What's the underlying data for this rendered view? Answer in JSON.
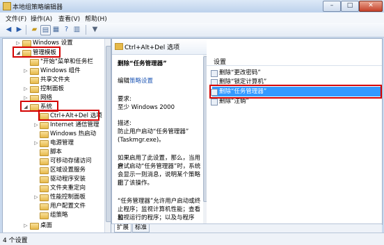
{
  "window": {
    "title": "本地组策略编辑器",
    "min": "–",
    "max": "□",
    "close": "✕"
  },
  "menu": [
    "文件(F)",
    "操作(A)",
    "查看(V)",
    "帮助(H)"
  ],
  "toolbar_icons": [
    "back-icon",
    "forward-icon",
    "folder-up-icon",
    "show-hide-tree-icon",
    "properties-icon",
    "help-icon",
    "export-list-icon",
    "filter-icon"
  ],
  "tree": {
    "items": [
      {
        "label": "Windows 设置",
        "arrow": "▷"
      },
      {
        "label": "管理模板",
        "arrow": "◢"
      },
      {
        "label": "\"开始\"菜单和任务栏",
        "arrow": ""
      },
      {
        "label": "Windows 组件",
        "arrow": "▷"
      },
      {
        "label": "共享文件夹",
        "arrow": ""
      },
      {
        "label": "控制面板",
        "arrow": "▷"
      },
      {
        "label": "网络",
        "arrow": "▷"
      },
      {
        "label": "系统",
        "arrow": "◢"
      },
      {
        "label": "Ctrl+Alt+Del 选项",
        "arrow": ""
      },
      {
        "label": "Internet 通信管理",
        "arrow": "▷"
      },
      {
        "label": "Windows 热启动",
        "arrow": ""
      },
      {
        "label": "电源管理",
        "arrow": "▷"
      },
      {
        "label": "脚本",
        "arrow": ""
      },
      {
        "label": "可移动存储访问",
        "arrow": ""
      },
      {
        "label": "区域设置服务",
        "arrow": ""
      },
      {
        "label": "驱动程序安装",
        "arrow": ""
      },
      {
        "label": "文件夹重定向",
        "arrow": ""
      },
      {
        "label": "性能控制面板",
        "arrow": "▷"
      },
      {
        "label": "用户配置文件",
        "arrow": ""
      },
      {
        "label": "组策略",
        "arrow": ""
      },
      {
        "label": "桌面",
        "arrow": "▷"
      }
    ]
  },
  "desc": {
    "header": "Ctrl+Alt+Del 选项",
    "policy_title": "删除“任务管理器”",
    "edit_prefix": "编辑",
    "edit_link": "策略设置",
    "req_label": "要求:",
    "req_value": "至少 Windows 2000",
    "desc_label": "描述:",
    "desc_lines": [
      "防止用户启动“任务管理器”",
      "(Taskmgr.exe)。"
    ],
    "para2": [
      "如果启用了此设置，那么，当用户",
      "尝试启动“任务管理器”时，系统",
      "会显示一则消息，说明某个策略阻",
      "止了该操作。"
    ],
    "para3": [
      "“任务管理器”允许用户启动或终",
      "止程序；监视计算机性能；查看和",
      "监视运行的程序；以及与程序"
    ]
  },
  "list": {
    "header": "设置",
    "rows": [
      "删除“更改密码”",
      "删除“锁定计算机”",
      "删除“任务管理器”",
      "删除“注销”"
    ]
  },
  "tabs": [
    "扩展",
    "标准"
  ],
  "status": "4 个设置",
  "colors": {
    "selection": "#3399ff",
    "highlight_box": "#d40000",
    "link": "#1f57b5"
  }
}
